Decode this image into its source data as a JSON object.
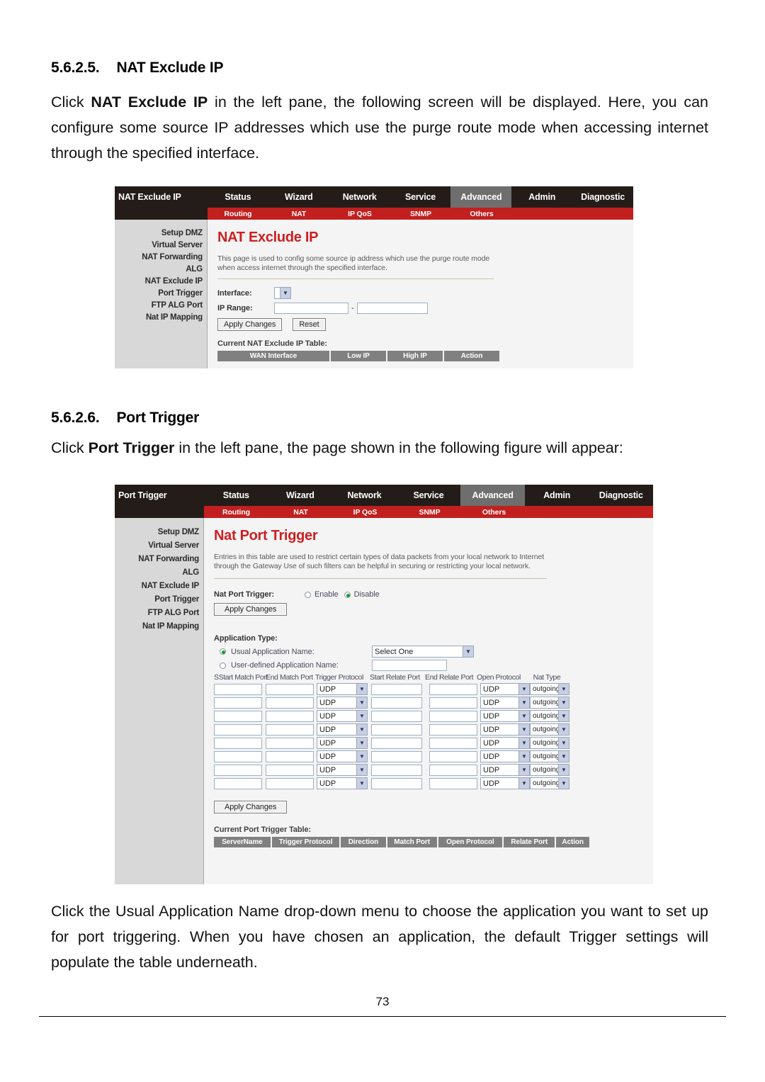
{
  "document": {
    "section1": {
      "number": "5.6.2.5.",
      "title": "NAT Exclude IP",
      "para_pre": "Click ",
      "para_bold": "NAT Exclude IP",
      "para_post": " in the left pane, the following screen will be displayed. Here, you can configure some source IP addresses which use the purge route mode when accessing internet through the specified interface."
    },
    "section2": {
      "number": "5.6.2.6.",
      "title": "Port Trigger",
      "para_pre": "Click ",
      "para_bold": "Port Trigger",
      "para_post": " in the left pane, the page shown in the following figure will appear:"
    },
    "closing_paragraph": "Click the Usual Application Name drop-down menu to choose the application you want to set up for port triggering. When you have chosen an application, the default Trigger settings will populate the table underneath.",
    "page_number": "73"
  },
  "colors": {
    "brand_red": "#c1201f",
    "title_red": "#cf1e21",
    "header_dark": "#231c19",
    "active_tab_gray": "#6e6e6e",
    "table_header_gray": "#808080",
    "sidebar_gray": "#d8d8d8"
  },
  "shot1": {
    "brand_label": "NAT Exclude IP",
    "topnav": [
      {
        "label": "Status",
        "active": false
      },
      {
        "label": "Wizard",
        "active": false
      },
      {
        "label": "Network",
        "active": false
      },
      {
        "label": "Service",
        "active": false
      },
      {
        "label": "Advanced",
        "active": true
      },
      {
        "label": "Admin",
        "active": false
      },
      {
        "label": "Diagnostic",
        "active": false
      }
    ],
    "subnav": [
      {
        "label": "Routing"
      },
      {
        "label": "NAT"
      },
      {
        "label": "IP QoS"
      },
      {
        "label": "SNMP"
      },
      {
        "label": "Others"
      }
    ],
    "sidebar": [
      "Setup DMZ",
      "Virtual Server",
      "NAT Forwarding",
      "ALG",
      "NAT Exclude IP",
      "Port Trigger",
      "FTP ALG Port",
      "Nat IP Mapping"
    ],
    "page_title": "NAT Exclude IP",
    "page_desc": "This page is used to config some source ip address which use the purge route mode when access internet through the specified interface.",
    "form": {
      "interface_label": "Interface:",
      "interface_value": "",
      "ip_range_label": "IP Range:",
      "ip_range_low": "",
      "ip_range_high": "",
      "range_separator": "-",
      "apply_button": "Apply Changes",
      "reset_button": "Reset"
    },
    "table": {
      "caption": "Current NAT Exclude IP Table:",
      "columns": [
        "WAN Interface",
        "Low IP",
        "High IP",
        "Action"
      ],
      "rows": []
    }
  },
  "shot2": {
    "brand_label": "Port Trigger",
    "topnav": [
      {
        "label": "Status",
        "active": false
      },
      {
        "label": "Wizard",
        "active": false
      },
      {
        "label": "Network",
        "active": false
      },
      {
        "label": "Service",
        "active": false
      },
      {
        "label": "Advanced",
        "active": true
      },
      {
        "label": "Admin",
        "active": false
      },
      {
        "label": "Diagnostic",
        "active": false
      }
    ],
    "subnav": [
      {
        "label": "Routing"
      },
      {
        "label": "NAT"
      },
      {
        "label": "IP QoS"
      },
      {
        "label": "SNMP"
      },
      {
        "label": "Others"
      }
    ],
    "sidebar": [
      "Setup DMZ",
      "Virtual Server",
      "NAT Forwarding",
      "ALG",
      "NAT Exclude IP",
      "Port Trigger",
      "FTP ALG Port",
      "Nat IP Mapping"
    ],
    "page_title": "Nat Port Trigger",
    "page_desc": "Entries in this table are used to restrict certain types of data packets from your local network to Internet through the Gateway  Use of such filters can be helpful in securing or restricting your local network.",
    "form": {
      "nat_port_trigger_label": "Nat Port Trigger:",
      "enable_label": "Enable",
      "disable_label": "Disable",
      "enable_selected": false,
      "disable_selected": true,
      "apply_button_top": "Apply Changes",
      "application_type_label": "Application Type:",
      "usual_app_label": "Usual Application Name:",
      "usual_app_selected": true,
      "usual_app_value": "Select One",
      "user_defined_label": "User-defined Application Name:",
      "user_defined_selected": false,
      "user_defined_value": "",
      "apply_button_bottom": "Apply Changes"
    },
    "entry_table": {
      "columns": [
        "SStart Match Port",
        "End Match Port",
        "Trigger Protocol",
        "Start Relate Port",
        "End Relate Port",
        "Open Protocol",
        "Nat Type"
      ],
      "row_count": 8,
      "defaults": {
        "start_match_port": "",
        "end_match_port": "",
        "trigger_protocol": "UDP",
        "start_relate_port": "",
        "end_relate_port": "",
        "open_protocol": "UDP",
        "nat_type": "outgoing"
      }
    },
    "current_table": {
      "caption": "Current Port Trigger Table:",
      "columns": [
        "ServerName",
        "Trigger Protocol",
        "Direction",
        "Match Port",
        "Open Protocol",
        "Relate Port",
        "Action"
      ],
      "rows": []
    }
  }
}
